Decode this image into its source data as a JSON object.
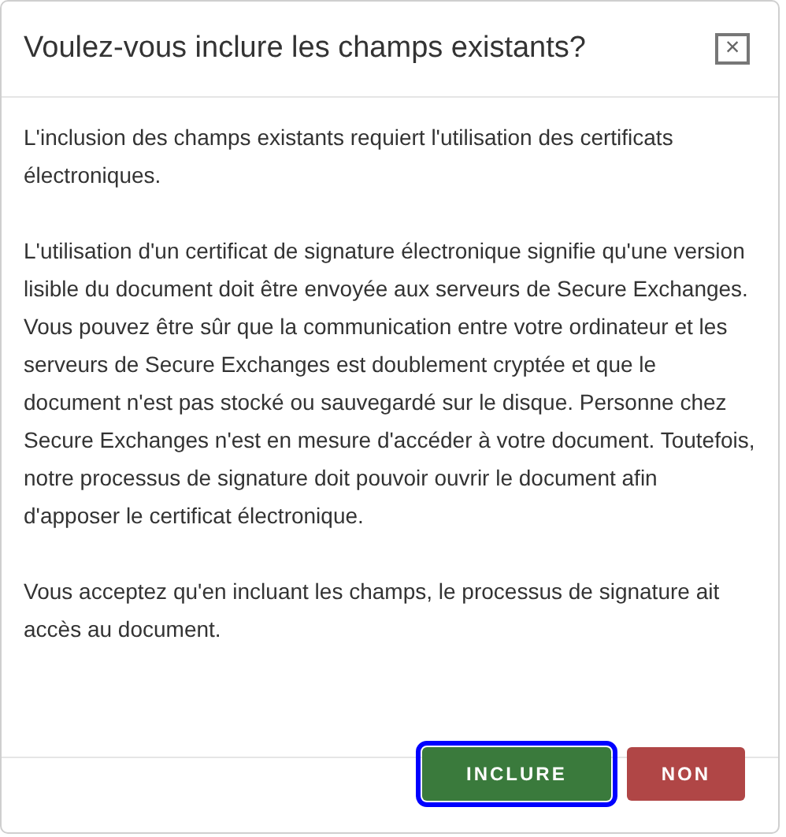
{
  "dialog": {
    "title": "Voulez-vous inclure les champs existants?",
    "close": "×",
    "paragraphs": [
      "L'inclusion des champs existants requiert l'utilisation des certificats électroniques.",
      "L'utilisation d'un certificat de signature électronique signifie qu'une version lisible du document doit être envoyée aux serveurs de Secure Exchanges. Vous pouvez être sûr que la communication entre votre ordinateur et les serveurs de Secure Exchanges est doublement cryptée et que le document n'est pas stocké ou sauvegardé sur le disque. Personne chez Secure Exchanges n'est en mesure d'accéder à votre document. Toutefois, notre processus de signature doit pouvoir ouvrir le document afin d'apposer le certificat électronique.",
      "Vous acceptez qu'en incluant les champs, le processus de signature ait accès au document."
    ],
    "buttons": [
      {
        "label": "INCLURE",
        "kind": "primary",
        "focused": true
      },
      {
        "label": "NON",
        "kind": "danger",
        "focused": false
      }
    ]
  }
}
